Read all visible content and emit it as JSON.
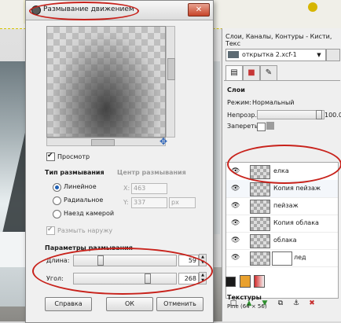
{
  "dialog": {
    "title": "Размывание движением",
    "close_glyph": "✕",
    "preview_label": "Просмотр",
    "blur_type": {
      "heading": "Тип размывания",
      "options": [
        "Линейное",
        "Радиальное",
        "Наезд камерой"
      ],
      "selected": "Линейное"
    },
    "blur_center": {
      "heading": "Центр размывания",
      "x_label": "X:",
      "x_value": "463",
      "y_label": "Y:",
      "y_value": "337",
      "unit": "px"
    },
    "blur_outward_label": "Размыть наружу",
    "params": {
      "heading": "Параметры размывания",
      "length_label": "Длина:",
      "length_value": "59",
      "angle_label": "Угол:",
      "angle_value": "268"
    },
    "buttons": {
      "help": "Справка",
      "ok": "ОК",
      "cancel": "Отменить"
    }
  },
  "panel": {
    "title": "Слои, Каналы, Контуры - Кисти, Текс",
    "image_name": "открытка 2.xcf-1",
    "layers_heading": "Слои",
    "mode_label": "Режим:",
    "mode_value": "Нормальный",
    "opacity_label": "Непрозр.:",
    "opacity_value": "100.0",
    "lock_label": "Запереть:",
    "layers": [
      {
        "name": "елка"
      },
      {
        "name": "Копия пейзаж"
      },
      {
        "name": "пейзаж"
      },
      {
        "name": "Копия облака"
      },
      {
        "name": "облака"
      },
      {
        "name": "лед"
      }
    ],
    "textures_label": "Текстуры",
    "texture_name": "Pine (64 × 56)"
  },
  "colors": {
    "accent_red": "#c8221b",
    "radio_blue": "#1e5fb4"
  },
  "icons": [
    "motion-blur-icon",
    "eye-icon",
    "chain-icon",
    "navigate-cross-icon"
  ]
}
